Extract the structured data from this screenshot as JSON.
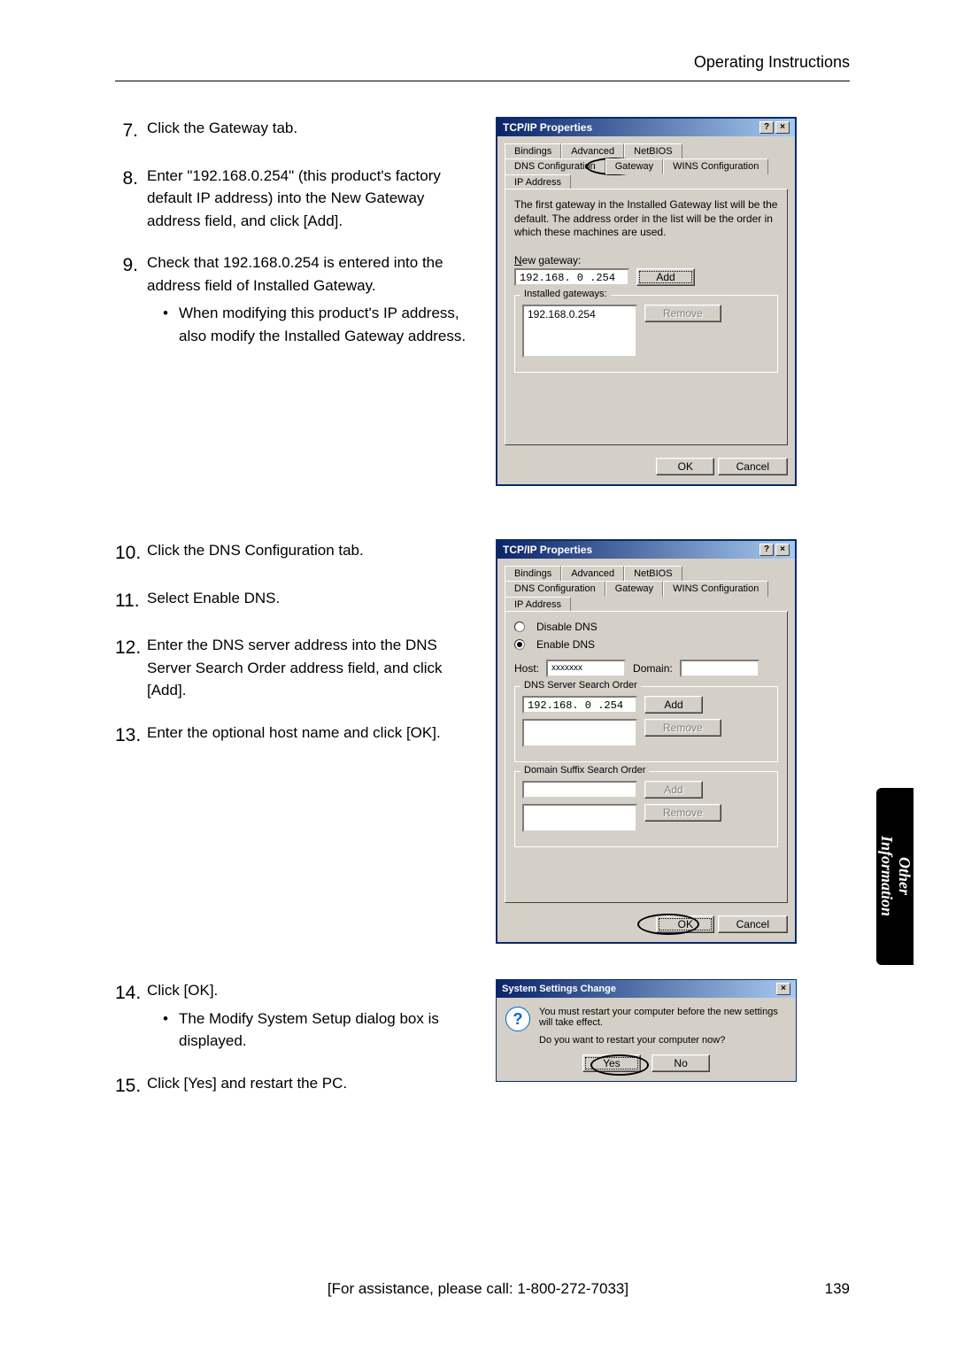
{
  "header": "Operating Instructions",
  "steps": {
    "s7": {
      "num": "7.",
      "text": "Click the Gateway tab."
    },
    "s8": {
      "num": "8.",
      "text": "Enter \"192.168.0.254\" (this product's factory default IP address) into the New Gateway address field, and click [Add]."
    },
    "s9": {
      "num": "9.",
      "text": "Check that 192.168.0.254 is entered into the address field of Installed Gateway.",
      "bullet": "When modifying this product's IP address, also modify the Installed Gateway address."
    },
    "s10": {
      "num": "10.",
      "text": "Click the DNS Configuration tab."
    },
    "s11": {
      "num": "11.",
      "text": "Select Enable DNS."
    },
    "s12": {
      "num": "12.",
      "text": "Enter the DNS server address into the DNS Server Search Order address field, and click [Add]."
    },
    "s13": {
      "num": "13.",
      "text": "Enter the optional host name and click [OK]."
    },
    "s14": {
      "num": "14.",
      "text": "Click [OK].",
      "bullet": "The Modify System Setup dialog box is displayed."
    },
    "s15": {
      "num": "15.",
      "text": "Click [Yes] and restart the PC."
    }
  },
  "dlg1": {
    "title": "TCP/IP Properties",
    "tabs_row1": [
      "Bindings",
      "Advanced",
      "NetBIOS"
    ],
    "tabs_row2": [
      "DNS Configuration",
      "Gateway",
      "WINS Configuration",
      "IP Address"
    ],
    "info": "The first gateway in the Installed Gateway list will be the default. The address order in the list will be the order in which these machines are used.",
    "new_gw_label": "New gateway:",
    "new_gw_value": "192.168. 0 .254",
    "add": "Add",
    "installed_label": "Installed gateways:",
    "installed_value": "192.168.0.254",
    "remove": "Remove",
    "ok": "OK",
    "cancel": "Cancel"
  },
  "dlg2": {
    "title": "TCP/IP Properties",
    "tabs_row1": [
      "Bindings",
      "Advanced",
      "NetBIOS"
    ],
    "tabs_row2": [
      "DNS Configuration",
      "Gateway",
      "WINS Configuration",
      "IP Address"
    ],
    "disable": "Disable DNS",
    "enable": "Enable DNS",
    "host_label": "Host:",
    "host_value": "xxxxxxx",
    "domain_label": "Domain:",
    "dns_order": "DNS Server Search Order",
    "dns_value": "192.168. 0 .254",
    "add": "Add",
    "remove": "Remove",
    "suffix_order": "Domain Suffix Search Order",
    "add2": "Add",
    "remove2": "Remove",
    "ok": "OK",
    "cancel": "Cancel"
  },
  "dlg3": {
    "title": "System Settings Change",
    "line1": "You must restart your computer before the new settings will take effect.",
    "line2": "Do you want to restart your computer now?",
    "yes": "Yes",
    "no": "No"
  },
  "sidetab": "Other\nInformation",
  "footer": "[For assistance, please call: 1-800-272-7033]",
  "page": "139"
}
